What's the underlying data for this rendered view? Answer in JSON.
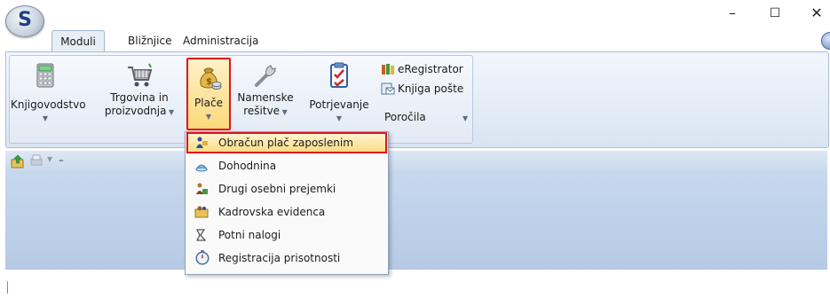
{
  "window": {
    "logo_letter": "S",
    "minimize": "–",
    "maximize": "☐",
    "close": "✕"
  },
  "tabs": [
    {
      "label": "Moduli",
      "active": true
    },
    {
      "label": "Bližnjice",
      "active": false
    },
    {
      "label": "Administracija",
      "active": false
    }
  ],
  "ribbon": {
    "buttons": [
      {
        "label": "Knjigovodstvo",
        "icon": "calculator-icon",
        "has_dropdown": true
      },
      {
        "label_line1": "Trgovina in",
        "label_line2": "proizvodnja",
        "icon": "shopping-cart-icon",
        "has_dropdown": true
      },
      {
        "label": "Plače",
        "icon": "money-bag-icon",
        "has_dropdown": true,
        "highlighted": true
      },
      {
        "label_line1": "Namenske",
        "label_line2": "rešitve",
        "icon": "wrench-icon",
        "has_dropdown": true
      },
      {
        "label": "Potrjevanje",
        "icon": "checklist-icon",
        "has_dropdown": false
      }
    ],
    "small_buttons": [
      {
        "label": "eRegistrator",
        "icon": "books-icon"
      },
      {
        "label": "Knjiga pošte",
        "icon": "mail-book-icon"
      },
      {
        "label": "Poročila",
        "icon": "",
        "has_dropdown": true
      }
    ]
  },
  "menu": {
    "items": [
      {
        "label": "Obračun plač zaposlenim",
        "icon": "payroll-icon",
        "highlighted": true
      },
      {
        "label": "Dohodnina",
        "icon": "tax-icon"
      },
      {
        "label": "Drugi osebni prejemki",
        "icon": "receipts-icon"
      },
      {
        "label": "Kadrovska evidenca",
        "icon": "staff-records-icon"
      },
      {
        "label": "Potni nalogi",
        "icon": "travel-order-icon"
      },
      {
        "label": "Registracija prisotnosti",
        "icon": "stopwatch-icon"
      }
    ]
  },
  "colors": {
    "highlight_border": "#e0141e",
    "highlight_fill": "#fcdc85",
    "ribbon_bg": "#e4ecf6",
    "workspace_bg": "#bccfe8"
  }
}
